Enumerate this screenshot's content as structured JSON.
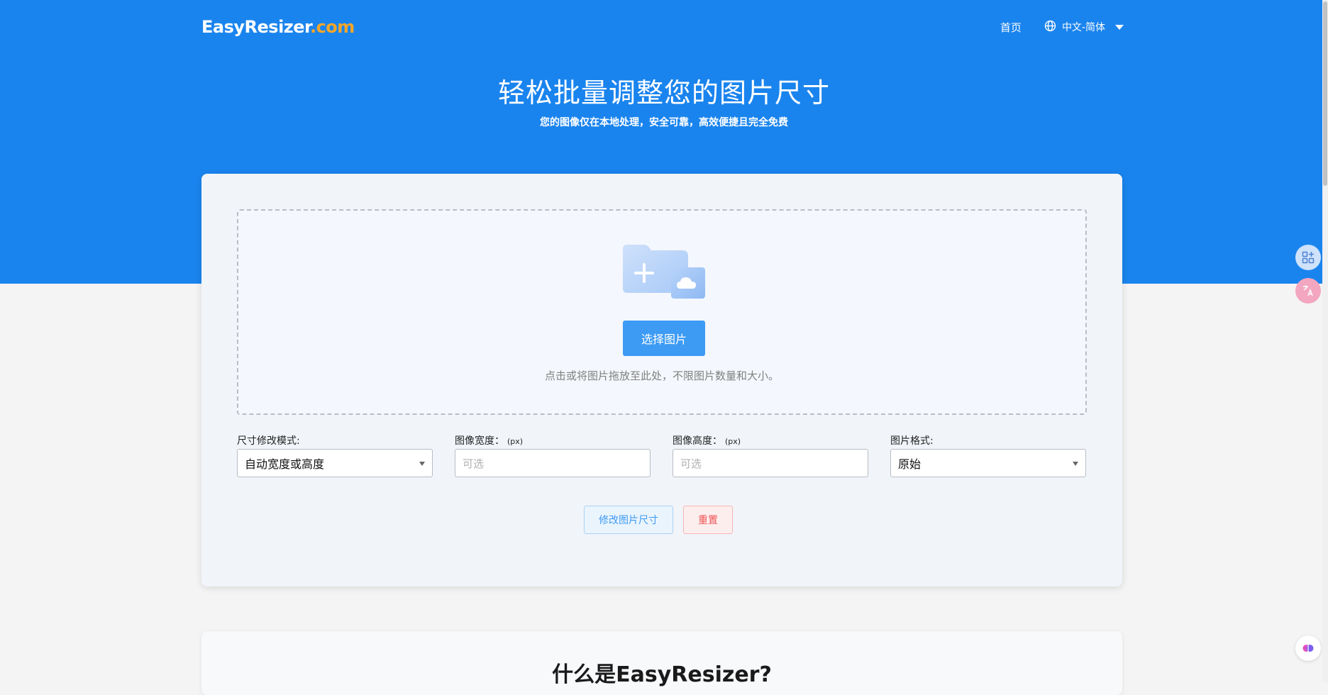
{
  "header": {
    "logo_main": "EasyResizer",
    "logo_domain": ".com",
    "nav_home": "首页",
    "language": "中文-简体"
  },
  "hero": {
    "title": "轻松批量调整您的图片尺寸",
    "subtitle": "您的图像仅在本地处理，安全可靠，高效便捷且完全免费"
  },
  "upload": {
    "button_label": "选择图片",
    "hint": "点击或将图片拖放至此处，不限图片数量和大小。"
  },
  "settings": {
    "mode": {
      "label": "尺寸修改模式:",
      "value": "自动宽度或高度"
    },
    "width": {
      "label": "图像宽度：",
      "unit": "(px)",
      "placeholder": "可选"
    },
    "height": {
      "label": "图像高度：",
      "unit": "(px)",
      "placeholder": "可选"
    },
    "format": {
      "label": "图片格式:",
      "value": "原始"
    }
  },
  "actions": {
    "resize_label": "修改图片尺寸",
    "reset_label": "重置"
  },
  "about": {
    "title": "什么是EasyResizer?"
  },
  "colors": {
    "brand_blue": "#1a84ee",
    "accent_orange": "#f4a62a",
    "primary_button": "#3d9bf4",
    "danger": "#f05454"
  }
}
